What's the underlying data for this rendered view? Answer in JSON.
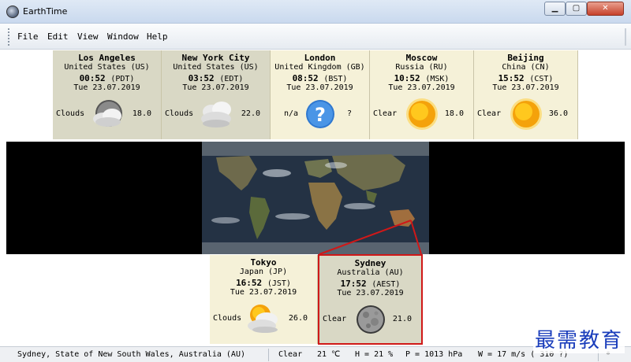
{
  "window": {
    "title": "EarthTime",
    "controls": {
      "minimize": "▁",
      "maximize": "▢",
      "close": "✕"
    }
  },
  "menu": {
    "file": "File",
    "edit": "Edit",
    "view": "View",
    "window": "Window",
    "help": "Help"
  },
  "top_cities": [
    {
      "name": "Los Angeles",
      "country": "United States (US)",
      "time": "00:52",
      "tz": "(PDT)",
      "date": "Tue 23.07.2019",
      "condition": "Clouds",
      "temp": "18.0",
      "icon": "clouds-night-icon"
    },
    {
      "name": "New York City",
      "country": "United States (US)",
      "time": "03:52",
      "tz": "(EDT)",
      "date": "Tue 23.07.2019",
      "condition": "Clouds",
      "temp": "22.0",
      "icon": "clouds-icon"
    },
    {
      "name": "London",
      "country": "United Kingdom (GB)",
      "time": "08:52",
      "tz": "(BST)",
      "date": "Tue 23.07.2019",
      "condition": "n/a",
      "temp": "?",
      "icon": "question-icon"
    },
    {
      "name": "Moscow",
      "country": "Russia (RU)",
      "time": "10:52",
      "tz": "(MSK)",
      "date": "Tue 23.07.2019",
      "condition": "Clear",
      "temp": "18.0",
      "icon": "sun-icon"
    },
    {
      "name": "Beijing",
      "country": "China (CN)",
      "time": "15:52",
      "tz": "(CST)",
      "date": "Tue 23.07.2019",
      "condition": "Clear",
      "temp": "36.0",
      "icon": "sun-icon"
    }
  ],
  "bottom_cities": [
    {
      "name": "Tokyo",
      "country": "Japan (JP)",
      "time": "16:52",
      "tz": "(JST)",
      "date": "Tue 23.07.2019",
      "condition": "Clouds",
      "temp": "26.0",
      "icon": "clouds-sun-icon"
    },
    {
      "name": "Sydney",
      "country": "Australia (AU)",
      "time": "17:52",
      "tz": "(AEST)",
      "date": "Tue 23.07.2019",
      "condition": "Clear",
      "temp": "21.0",
      "icon": "moon-icon"
    }
  ],
  "status": {
    "location": "Sydney, State of New South Wales, Australia (AU)",
    "condition": "Clear",
    "temperature": "21 ℃",
    "humidity": "H = 21 %",
    "pressure": "P = 1013 hPa",
    "wind": "W = 17 m/s  ( 310 ?)",
    "indicator": "*"
  },
  "watermark": "最需教育",
  "colors": {
    "panel": "#f5f1d8",
    "panel_dim": "#d9d8c5",
    "selection": "#d01818",
    "watermark": "#1a3dbb"
  }
}
